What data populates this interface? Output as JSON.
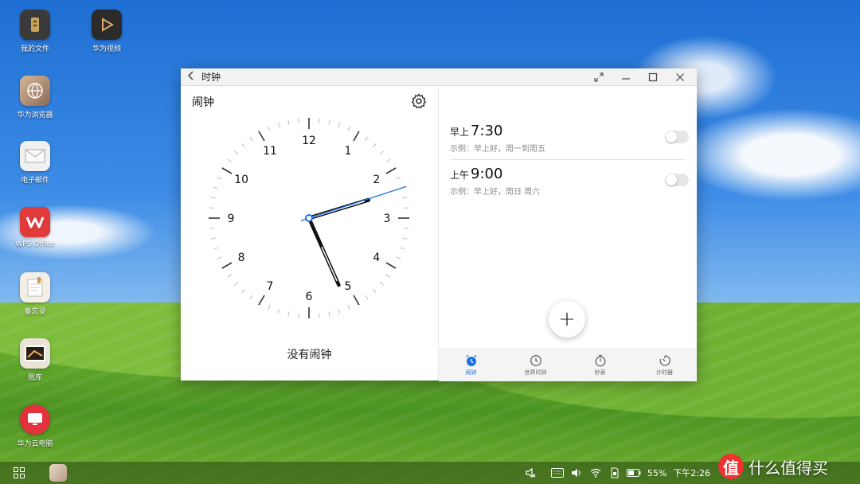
{
  "desktop": {
    "icons": [
      {
        "label": "我的文件"
      },
      {
        "label": "华为视频"
      },
      {
        "label": "华为浏览器"
      },
      {
        "label": "电子邮件"
      },
      {
        "label": "WPS Office"
      },
      {
        "label": "备忘录"
      },
      {
        "label": "图库"
      },
      {
        "label": "华为云电脑"
      }
    ]
  },
  "window": {
    "title": "时钟",
    "left": {
      "title": "闹钟",
      "no_alarm": "没有闹钟",
      "clock": {
        "numerals": [
          "12",
          "1",
          "2",
          "3",
          "4",
          "5",
          "6",
          "7",
          "8",
          "9",
          "10",
          "11"
        ],
        "time": "2:26",
        "hour": 2,
        "minute": 26,
        "second": 12
      }
    },
    "alarms": [
      {
        "period": "早上",
        "time": "7:30",
        "desc": "示例：早上好，周一到周五",
        "enabled": false
      },
      {
        "period": "上午",
        "time": "9:00",
        "desc": "示例：早上好，周日 周六",
        "enabled": false
      }
    ],
    "add_button": "+",
    "tabs": [
      {
        "label": "闹钟",
        "active": true
      },
      {
        "label": "世界时钟",
        "active": false
      },
      {
        "label": "秒表",
        "active": false
      },
      {
        "label": "计时器",
        "active": false
      }
    ]
  },
  "taskbar": {
    "battery": "55%",
    "time": "下午2:26"
  },
  "watermark": {
    "logo_char": "值",
    "text": "什么值得买"
  },
  "colors": {
    "accent": "#1a73e8"
  }
}
